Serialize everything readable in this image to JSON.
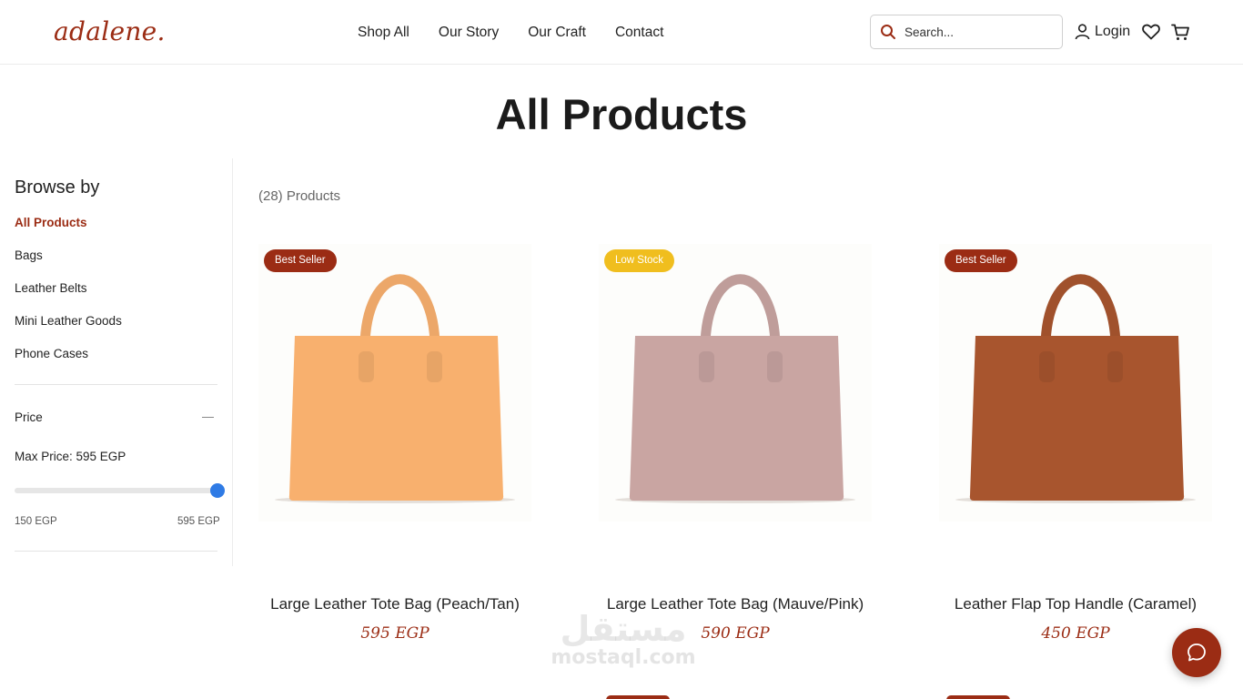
{
  "header": {
    "logo": "adalene.",
    "nav": [
      "Shop All",
      "Our Story",
      "Our Craft",
      "Contact"
    ],
    "search_placeholder": "Search...",
    "login_label": "Login",
    "icons": [
      "search-icon",
      "user-icon",
      "heart-icon",
      "cart-icon"
    ]
  },
  "page_title": "All Products",
  "sidebar": {
    "browse_title": "Browse by",
    "categories": [
      {
        "label": "All Products",
        "active": true
      },
      {
        "label": "Bags",
        "active": false
      },
      {
        "label": "Leather Belts",
        "active": false
      },
      {
        "label": "Mini Leather Goods",
        "active": false
      },
      {
        "label": "Phone Cases",
        "active": false
      }
    ],
    "price": {
      "label": "Price",
      "max_label": "Max Price: 595 EGP",
      "min_value": "150 EGP",
      "max_value": "595 EGP",
      "slider_fraction": 1.0
    }
  },
  "products": {
    "count_label": "(28) Products",
    "items": [
      {
        "name": "Large Leather Tote Bag (Peach/Tan)",
        "price": "595 EGP",
        "badge": "Best Seller",
        "badge_type": "best",
        "color": "#f8b06e"
      },
      {
        "name": "Large Leather Tote Bag (Mauve/Pink)",
        "price": "590 EGP",
        "badge": "Low Stock",
        "badge_type": "low",
        "color": "#c9a5a2"
      },
      {
        "name": "Leather Flap Top Handle (Caramel)",
        "price": "450 EGP",
        "badge": "Best Seller",
        "badge_type": "best",
        "color": "#a8552e"
      }
    ]
  },
  "watermark": {
    "arabic": "مستقل",
    "latin": "mostaql.com"
  },
  "colors": {
    "brand": "#9b2c14",
    "low_stock": "#f0be1e",
    "slider": "#2f7be5"
  }
}
